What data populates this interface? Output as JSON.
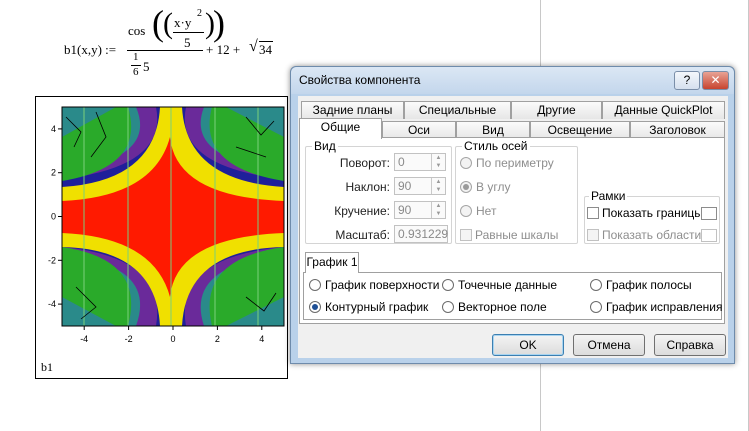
{
  "formula": {
    "lhs": "b1(x,y) :=",
    "cos": "cos",
    "num_top": "x·y",
    "exp": "2",
    "five": "5",
    "one": "1",
    "six": "6",
    "five2": "5",
    "plus12": "+ 12 +",
    "sqrt_arg": "34"
  },
  "plot": {
    "name": "b1",
    "x_ticks": [
      "-4",
      "-2",
      "0",
      "2",
      "4"
    ],
    "y_ticks": [
      "4",
      "2",
      "0",
      "-2",
      "-4"
    ]
  },
  "chart_data": {
    "type": "heatmap",
    "function": "b1(x,y) = cos(((x·y^2)/5)) / ((1/6)·5) + 12 + √34",
    "x_range": [
      -5,
      5
    ],
    "y_range": [
      -5,
      5
    ],
    "xticks": [
      -4,
      -2,
      0,
      2,
      4
    ],
    "yticks": [
      -4,
      -2,
      0,
      2,
      4
    ],
    "colormap": [
      "#1a1a9a",
      "#6a2a9a",
      "#2a8a8a",
      "#2aaa2a",
      "#f0e000",
      "#ff1a00"
    ],
    "plot_type": "contour"
  },
  "dialog": {
    "title": "Свойства компонента",
    "help": "?",
    "close": "✕",
    "tabs_back": [
      "Задние планы",
      "Специальные",
      "Другие",
      "Данные QuickPlot"
    ],
    "tabs_front": [
      "Общие",
      "Оси",
      "Вид",
      "Освещение",
      "Заголовок"
    ],
    "view": {
      "title": "Вид",
      "rotation_label": "Поворот:",
      "rotation": "0",
      "tilt_label": "Наклон:",
      "tilt": "90",
      "twist_label": "Кручение:",
      "twist": "90",
      "scale_label": "Масштаб:",
      "scale": "0.931229"
    },
    "axes_style": {
      "title": "Стиль осей",
      "perimeter": "По периметру",
      "corner": "В углу",
      "none": "Нет",
      "equal": "Равные шкалы"
    },
    "frames": {
      "title": "Рамки",
      "show_borders": "Показать границы",
      "show_areas": "Показать области"
    },
    "plot1": {
      "tab": "График 1",
      "surface": "График поверхности",
      "scatter": "Точечные данные",
      "bar": "График полосы",
      "contour": "Контурный график",
      "vector": "Векторное поле",
      "patch": "График исправления"
    },
    "buttons": {
      "ok": "OK",
      "cancel": "Отмена",
      "help": "Справка"
    }
  }
}
